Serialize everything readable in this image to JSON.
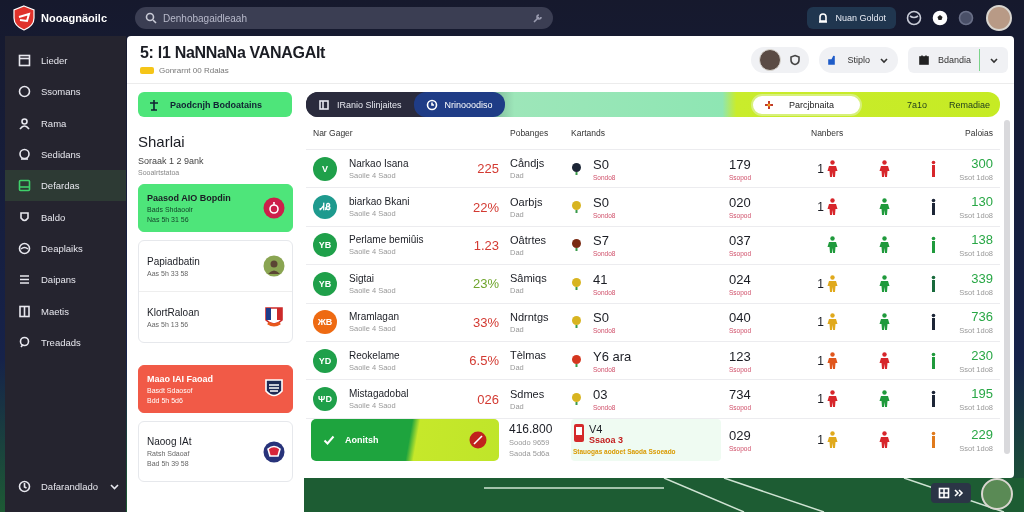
{
  "topbar": {
    "app_name": "Nooagnäoilc",
    "search": {
      "placeholder": "Denhobagaidleaah"
    },
    "action_button": "Nuan Goldot"
  },
  "sidebar": {
    "items": [
      {
        "label": "Lieder",
        "selected": false
      },
      {
        "label": "Ssomans",
        "selected": false
      },
      {
        "label": "Rama",
        "selected": false
      },
      {
        "label": "Sedidans",
        "selected": false
      },
      {
        "label": "Defardas",
        "selected": true
      },
      {
        "label": "Baldo",
        "selected": false
      },
      {
        "label": "Deaplaiks",
        "selected": false
      },
      {
        "label": "Daipans",
        "selected": false
      },
      {
        "label": "Maetis",
        "selected": false
      },
      {
        "label": "Treadads",
        "selected": false
      }
    ],
    "footer": "Dafarandlado"
  },
  "header": {
    "title": "5: l1 NaNNaNa VANAGAIt",
    "subtitle": "Gonrarnt 00 Rdalas",
    "filter": "Stiplo",
    "date_button": "Bdandia"
  },
  "left": {
    "action_button": "Paodcnjh Bodoatains",
    "heading": "Sharlai",
    "subheading": "Soraak 1 2 9ank",
    "caption": "Sooalrtstatoa",
    "cards": [
      {
        "kind": "success",
        "entries": [
          {
            "title": "Paasod AIO Bopdin",
            "lines": [
              "Bads Shdaoolr",
              "Nas 5h 31 56"
            ]
          }
        ]
      },
      {
        "kind": "plain",
        "entries": [
          {
            "title": "Papiadbatin",
            "lines": [
              "Aas 5h 33 58"
            ]
          },
          {
            "title": "KlortRaloan",
            "lines": [
              "Aas 5h 13 56"
            ]
          }
        ]
      },
      {
        "kind": "danger",
        "entries": [
          {
            "title": "Maao IAI Faoad",
            "lines": [
              "Basdt Sdaosof",
              "Bdd 5h 5d6"
            ]
          }
        ]
      },
      {
        "kind": "plain",
        "entries": [
          {
            "title": "Naoog IAt",
            "lines": [
              "Ratsh Sdaoaf",
              "Bad 5h 39 58"
            ]
          }
        ]
      }
    ]
  },
  "table": {
    "tabs": [
      {
        "label": "IRanio Slinjaites",
        "selected": false
      },
      {
        "label": "Nrinooodiso",
        "selected": true
      }
    ],
    "chip": "Parcjbnaita",
    "toolbar_texts": [
      "7a1o",
      "Remadiae"
    ],
    "columns": [
      "Nar Gager",
      "Pobanges",
      "Kartands",
      "Nanbers",
      "Paloias"
    ],
    "rows": [
      {
        "kind": "team",
        "logo": {
          "text": "V",
          "color": "#1fa04a"
        },
        "name": "Narkao Isana",
        "sub": "Saoile 4 Saod",
        "pct": {
          "text": "225",
          "color": "#d33a32"
        },
        "col3": "Cåndjs",
        "col3_sub": "Dad",
        "ball": {
          "color": "#1c2536"
        },
        "score": "S0",
        "score_sub": "Sondo8",
        "count": "179",
        "count_sub": "Ssopod",
        "marks": [
          {
            "prefix": "1",
            "color": "#d7262b"
          },
          {
            "color": "#d7262b"
          },
          {
            "color": "#d7262b"
          }
        ],
        "total": "300",
        "total_sub": "Ssot 1do8"
      },
      {
        "kind": "team",
        "logo": {
          "text": "ᏗᏰ",
          "color": "#1e9a8e"
        },
        "name": "biarkao Bkani",
        "sub": "Saoile 4 Saod",
        "pct": {
          "text": "22%",
          "color": "#d33a32"
        },
        "col3": "Oarbjs",
        "col3_sub": "Dad",
        "ball": {
          "color": "#d8b420"
        },
        "score": "S0",
        "score_sub": "Sondo8",
        "count": "020",
        "count_sub": "Ssopod",
        "marks": [
          {
            "prefix": "1",
            "color": "#d7262b"
          },
          {
            "color": "#1f9a3c"
          },
          {
            "color": "#1c2536"
          }
        ],
        "total": "130",
        "total_sub": "Ssot 1do8"
      },
      {
        "kind": "team",
        "logo": {
          "text": "YB",
          "color": "#1fa04a"
        },
        "name": "Perlame bemiûis",
        "sub": "Saoile 4 Saod",
        "pct": {
          "text": "1.23",
          "color": "#d33a32"
        },
        "col3": "Oâtrtes",
        "col3_sub": "Dad",
        "ball": {
          "color": "#7a2a12"
        },
        "score": "S7",
        "score_sub": "Sondo8",
        "count": "037",
        "count_sub": "Ssopod",
        "marks": [
          {
            "color": "#1f9a3c"
          },
          {
            "color": "#1f9a3c"
          },
          {
            "color": "#1f9a3c"
          }
        ],
        "total": "138",
        "total_sub": "Ssot 1do8"
      },
      {
        "kind": "team",
        "logo": {
          "text": "YB",
          "color": "#1fa04a"
        },
        "name": "Sigtai",
        "sub": "Saoile 4 Saod",
        "pct": {
          "text": "23%",
          "color": "#6fa52c"
        },
        "col3": "Sâmiqs",
        "col3_sub": "Dad",
        "ball": {
          "color": "#d8b420"
        },
        "score": "41",
        "score_sub": "Sondo8",
        "count": "024",
        "count_sub": "Ssopod",
        "marks": [
          {
            "prefix": "1",
            "color": "#e0a91c"
          },
          {
            "color": "#1f9a3c"
          },
          {
            "color": "#186a3c"
          }
        ],
        "total": "339",
        "total_sub": "Ssot 1do8"
      },
      {
        "kind": "team",
        "logo": {
          "text": "ЖB",
          "color": "#ee6a12"
        },
        "name": "Mramlagan",
        "sub": "Saoile 4 Saod",
        "pct": {
          "text": "33%",
          "color": "#d33a32"
        },
        "col3": "Ndrntgs",
        "col3_sub": "Dad",
        "ball": {
          "color": "#d8b420"
        },
        "score": "S0",
        "score_sub": "Sondo8",
        "count": "040",
        "count_sub": "Ssopod",
        "marks": [
          {
            "prefix": "1",
            "color": "#e0a91c"
          },
          {
            "color": "#1f9a3c"
          },
          {
            "color": "#1c2536"
          }
        ],
        "total": "736",
        "total_sub": "Ssot 1do8"
      },
      {
        "kind": "team",
        "logo": {
          "text": "ΥD",
          "color": "#1fa04a"
        },
        "name": "Reokelame",
        "sub": "Saoile 4 Saod",
        "pct": {
          "text": "6.5%",
          "color": "#d33a32"
        },
        "col3": "Tèlmas",
        "col3_sub": "Dad",
        "ball": {
          "color": "#d4361e"
        },
        "score": "Y6 ara",
        "score_sub": "Sondo8",
        "count": "123",
        "count_sub": "Ssopod",
        "marks": [
          {
            "prefix": "1",
            "color": "#e0561c"
          },
          {
            "color": "#d7262b"
          },
          {
            "color": "#1f9a3c"
          }
        ],
        "total": "230",
        "total_sub": "Ssot 1do8"
      },
      {
        "kind": "team",
        "logo": {
          "text": "ΨD",
          "color": "#1fa04a"
        },
        "name": "Mistagadobal",
        "sub": "Saoile 4 Saod",
        "pct": {
          "text": "026",
          "color": "#d33a32"
        },
        "col3": "Sdmes",
        "col3_sub": "Dad",
        "ball": {
          "color": "#d8b420"
        },
        "score": "03",
        "score_sub": "Sondo8",
        "count": "734",
        "count_sub": "Ssopod",
        "marks": [
          {
            "prefix": "1",
            "color": "#d7262b"
          },
          {
            "color": "#1f9a3c"
          },
          {
            "color": "#1c2536"
          }
        ],
        "total": "195",
        "total_sub": "Ssot 1do8"
      },
      {
        "kind": "banner",
        "label": "Aonitsh",
        "value": "416.800",
        "value_lines": [
          "Soodo 9659",
          "Saoda 5d6a"
        ],
        "card_title": "V4",
        "card_text": "Ssaoa 3",
        "card_note": "Stauogas aodoet Saoda Ssoeado",
        "count": "029",
        "count_sub": "Ssopod",
        "marks": [
          {
            "prefix": "1",
            "color": "#e0a91c"
          },
          {
            "color": "#d7262b"
          },
          {
            "color": "#e07a1c"
          }
        ],
        "total": "229",
        "total_sub": "Ssot 1do8"
      }
    ]
  }
}
